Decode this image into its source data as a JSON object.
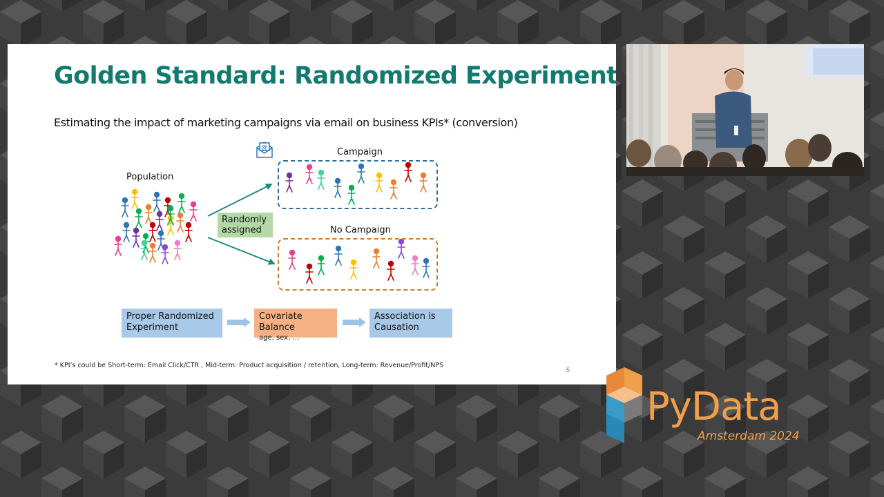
{
  "slide": {
    "title": "Golden Standard: Randomized Experiment",
    "subtitle": "Estimating the impact of marketing campaigns via email on business KPIs* (conversion)",
    "population_label": "Population",
    "campaign_label": "Campaign",
    "no_campaign_label": "No Campaign",
    "assign_label_line1": "Randomly",
    "assign_label_line2": "assigned",
    "email_icon": "email-at-icon",
    "flow": {
      "step1_line1": "Proper Randomized",
      "step1_line2": "Experiment",
      "step2_line1": "Covariate Balance",
      "step2_line2": "age, sex, …",
      "step3_line1": "Association is",
      "step3_line2": "Causation"
    },
    "footnote": "* KPI’s could be Short-term: Email Click/CTR , Mid-term: Product acquisition / retention, Long-term: Revenue/Profit/NPS",
    "page_number": "5"
  },
  "colors": {
    "title": "#137a6f",
    "arrow": "#1e8a7e",
    "campaign_border": "#2e6f9e",
    "no_campaign_border": "#d07a2a",
    "assign_box": "#b4d9a7",
    "flow_blue": "#a9c9e8",
    "flow_orange": "#f5b183",
    "people": [
      "#2e75b6",
      "#ffc000",
      "#00b050",
      "#c00000",
      "#7030a0",
      "#ed7d31",
      "#e83e8c",
      "#44d19a",
      "#f07cc8",
      "#8f44d8"
    ]
  },
  "logo": {
    "brand": "PyData",
    "event": "Amsterdam 2024"
  }
}
